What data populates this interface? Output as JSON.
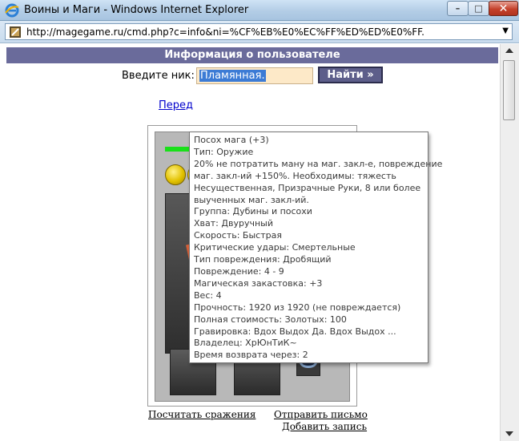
{
  "window": {
    "title": "Воины и Маги - Windows Internet Explorer",
    "min_glyph": "–",
    "max_glyph": "□",
    "close_glyph": "✕"
  },
  "address": {
    "url": "http://magegame.ru/cmd.php?c=info&ni=%CF%EB%E0%EC%FF%ED%ED%E0%FF."
  },
  "page": {
    "header": "Информация о пользователе",
    "nick_label": "Введите ник:",
    "nick_value": "Пламянная.",
    "find_button": "Найти »",
    "partial_link": "Перед",
    "bottom_links": {
      "count_battles": "Посчитать сражения",
      "send_letter": "Отправить письмо",
      "add_entry": "Добавить запись"
    }
  },
  "tooltip": {
    "lines": [
      "Посох мага (+3)",
      "Тип: Оружие",
      "20% не потратить ману на маг. закл-е, повреждение",
      "маг. закл-ий +150%. Необходимы: тяжесть",
      "Несущественная, Призрачные Руки, 8 или более",
      "выученных маг. закл-ий.",
      "Группа: Дубины и посохи",
      "Хват: Двуручный",
      "Скорость: Быстрая",
      "Критические удары: Смертельные",
      "Тип повреждения: Дробящий",
      "Повреждение: 4 - 9",
      "Магическая закастовка: +3",
      "Вес: 4",
      "Прочность: 1920 из 1920 (не повреждается)",
      "Полная стоимость: Золотых: 100",
      "Гравировка: Вдох Выдох Да. Вдох Выдох ...",
      "Владелец: ХрЮнТиК~",
      "Время возврата через: 2"
    ]
  },
  "icons": {
    "app": "ie-logo-icon",
    "page": "page-favicon-icon",
    "coin": "gold-coin-icon",
    "ring": "ring-icon",
    "staff": "staff-icon"
  },
  "colors": {
    "header_band": "#6a6b9b",
    "find_button": "#5d5e8a",
    "hp_bar": "#19e019",
    "input_bg": "#fde9c8",
    "selection": "#3c7bd5"
  }
}
